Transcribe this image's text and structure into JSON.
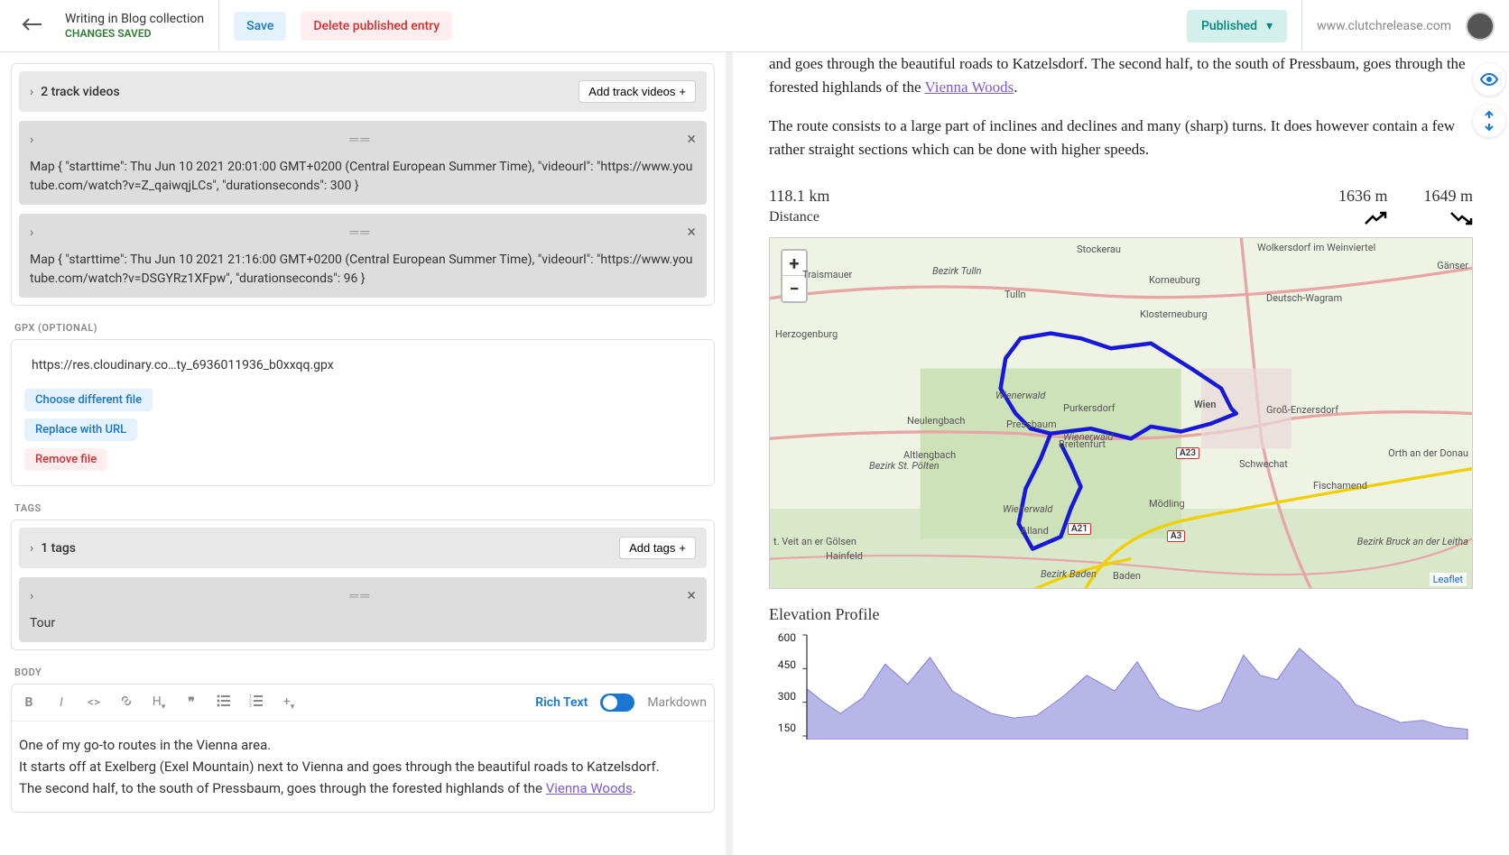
{
  "header": {
    "title": "Writing in Blog collection",
    "status": "CHANGES SAVED",
    "save_label": "Save",
    "delete_label": "Delete published entry",
    "published_label": "Published",
    "site_url": "www.clutchrelease.com"
  },
  "track_videos": {
    "header": "2 track videos",
    "add_label": "Add track videos",
    "items": [
      "Map { \"starttime\": Thu Jun 10 2021 20:01:00 GMT+0200 (Central European Summer Time), \"videourl\": \"https://www.youtube.com/watch?v=Z_qaiwqjLCs\", \"durationseconds\": 300 }",
      "Map { \"starttime\": Thu Jun 10 2021 21:16:00 GMT+0200 (Central European Summer Time), \"videourl\": \"https://www.youtube.com/watch?v=DSGYRz1XFpw\", \"durationseconds\": 96 }"
    ]
  },
  "gpx": {
    "label": "GPX (OPTIONAL)",
    "url": "https://res.cloudinary.co…ty_6936011936_b0xxqq.gpx",
    "choose": "Choose different file",
    "replace": "Replace with URL",
    "remove": "Remove file"
  },
  "tags": {
    "label": "TAGS",
    "header": "1 tags",
    "add_label": "Add tags",
    "items": [
      "Tour"
    ]
  },
  "body": {
    "label": "BODY",
    "richtext": "Rich Text",
    "markdown": "Markdown",
    "line1": "One of my go-to routes in the Vienna area.",
    "line2a": "It starts off at Exelberg (Exel Mountain) next to Vienna and goes through the beautiful roads to Katzelsdorf.",
    "line2b": "The second half, to the south of Pressbaum, goes through the forested highlands of the ",
    "link": "Vienna Woods",
    "line2c": "."
  },
  "preview": {
    "p1a": "and goes through the beautiful roads to Katzelsdorf. The second half, to the south of Pressbaum, goes through the forested highlands of the ",
    "p1link": "Vienna Woods",
    "p1b": ".",
    "p2": "The route consists to a large part of inclines and declines and many (sharp) turns. It does however contain a few rather straight sections which can be done with higher speeds.",
    "distance_val": "118.1 km",
    "distance_label": "Distance",
    "elev_up": "1636 m",
    "elev_down": "1649 m",
    "elev_title": "Elevation Profile",
    "leaflet": "Leaflet",
    "map_places": {
      "stockerau": "Stockerau",
      "wolkersdorf": "Wolkersdorf im Weinviertel",
      "ganser": "Gänser",
      "korneuburg": "Korneuburg",
      "tulln": "Tulln",
      "traismauer": "Traismauer",
      "bezirktulln": "Bezirk Tulln",
      "klosterneuburg": "Klosterneuburg",
      "dwagram": "Deutsch-Wagram",
      "herzogenburg": "Herzogenburg",
      "wien": "Wien",
      "gross": "Groß-Enzersdorf",
      "purk": "Purkersdorf",
      "wiener": "Wienerwald",
      "wienerw2": "Wienerwald",
      "neulengbach": "Neulengbach",
      "press": "Pressbaum",
      "breitenfurt": "Breitenfurt",
      "altlengbach": "Altlengbach",
      "stpolten": "Bezirk St. Pölten",
      "schwechat": "Schwechat",
      "orth": "Orth an der Donau",
      "fischamend": "Fischamend",
      "modling": "Mödling",
      "alland": "Alland",
      "stveit": "t. Veit an er Gölsen",
      "hainfeld": "Hainfeld",
      "bezirkbaden": "Bezirk Baden",
      "baden": "Baden",
      "bezbruck": "Bezirk Bruck an der Leitha"
    },
    "roads": {
      "a23": "A23",
      "a21": "A21",
      "a3": "A3"
    }
  },
  "chart_data": {
    "type": "area",
    "title": "Elevation Profile",
    "ylabel": "",
    "ylim": [
      150,
      600
    ],
    "yticks": [
      150,
      300,
      450,
      600
    ],
    "x_unit": "km",
    "y_unit": "m",
    "x": [
      0,
      3,
      6,
      10,
      14,
      18,
      22,
      26,
      30,
      33,
      37,
      41,
      46,
      50,
      55,
      59,
      63,
      66,
      70,
      74,
      78,
      81,
      84,
      88,
      92,
      95,
      98,
      102,
      106,
      110,
      114,
      118
    ],
    "values": [
      360,
      300,
      250,
      320,
      470,
      380,
      500,
      350,
      290,
      250,
      230,
      240,
      330,
      420,
      350,
      480,
      320,
      280,
      260,
      300,
      510,
      420,
      400,
      540,
      450,
      390,
      290,
      250,
      210,
      220,
      190,
      180
    ]
  }
}
